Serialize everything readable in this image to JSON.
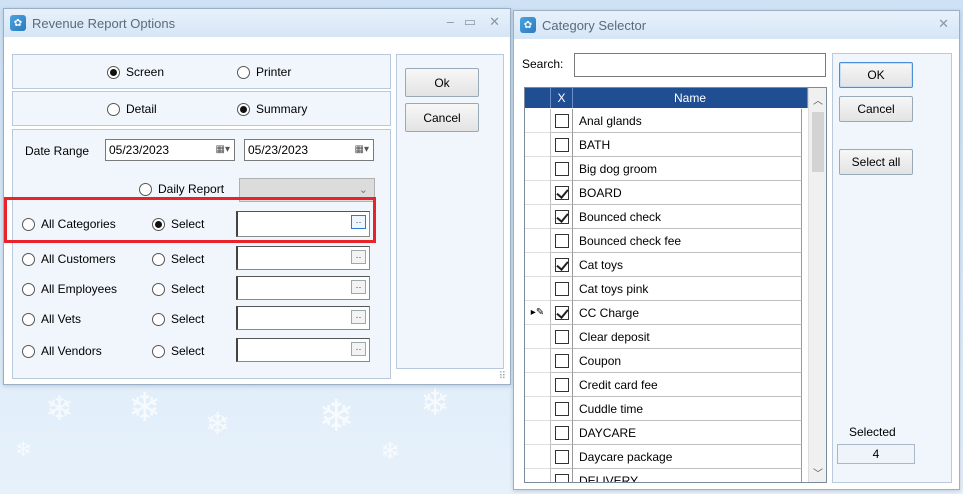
{
  "revenue_window": {
    "title": "Revenue Report Options",
    "output": {
      "screen": "Screen",
      "printer": "Printer",
      "selected": "screen"
    },
    "detail_level": {
      "detail": "Detail",
      "summary": "Summary",
      "selected": "summary"
    },
    "date_range": {
      "label": "Date Range",
      "from": "05/23/2023",
      "to": "05/23/2023"
    },
    "daily_report": {
      "label": "Daily Report"
    },
    "filters": [
      {
        "all_label": "All Categories",
        "select_label": "Select",
        "selected": "select",
        "value": ""
      },
      {
        "all_label": "All Customers",
        "select_label": "Select",
        "selected": "none",
        "value": ""
      },
      {
        "all_label": "All Employees",
        "select_label": "Select",
        "selected": "none",
        "value": ""
      },
      {
        "all_label": "All Vets",
        "select_label": "Select",
        "selected": "none",
        "value": ""
      },
      {
        "all_label": "All Vendors",
        "select_label": "Select",
        "selected": "none",
        "value": ""
      }
    ],
    "buttons": {
      "ok": "Ok",
      "cancel": "Cancel"
    }
  },
  "category_window": {
    "title": "Category Selector",
    "search": {
      "label": "Search:",
      "value": ""
    },
    "columns": {
      "x": "X",
      "name": "Name"
    },
    "rows": [
      {
        "name": "Anal glands",
        "checked": false
      },
      {
        "name": "BATH",
        "checked": false
      },
      {
        "name": "Big dog groom",
        "checked": false
      },
      {
        "name": "BOARD",
        "checked": true
      },
      {
        "name": "Bounced check",
        "checked": true
      },
      {
        "name": "Bounced check fee",
        "checked": false
      },
      {
        "name": "Cat toys",
        "checked": true
      },
      {
        "name": "Cat toys pink",
        "checked": false
      },
      {
        "name": "CC Charge",
        "checked": true,
        "current": true
      },
      {
        "name": "Clear deposit",
        "checked": false
      },
      {
        "name": "Coupon",
        "checked": false
      },
      {
        "name": "Credit card fee",
        "checked": false
      },
      {
        "name": "Cuddle time",
        "checked": false
      },
      {
        "name": "DAYCARE",
        "checked": false
      },
      {
        "name": "Daycare package",
        "checked": false
      },
      {
        "name": "DELIVERY",
        "checked": false
      }
    ],
    "buttons": {
      "ok": "OK",
      "cancel": "Cancel",
      "select_all": "Select all"
    },
    "selected": {
      "label": "Selected",
      "count": "4"
    }
  },
  "colors": {
    "header": "#1f4e93",
    "highlight": "#e8232a",
    "accent": "#2a7bd8"
  }
}
